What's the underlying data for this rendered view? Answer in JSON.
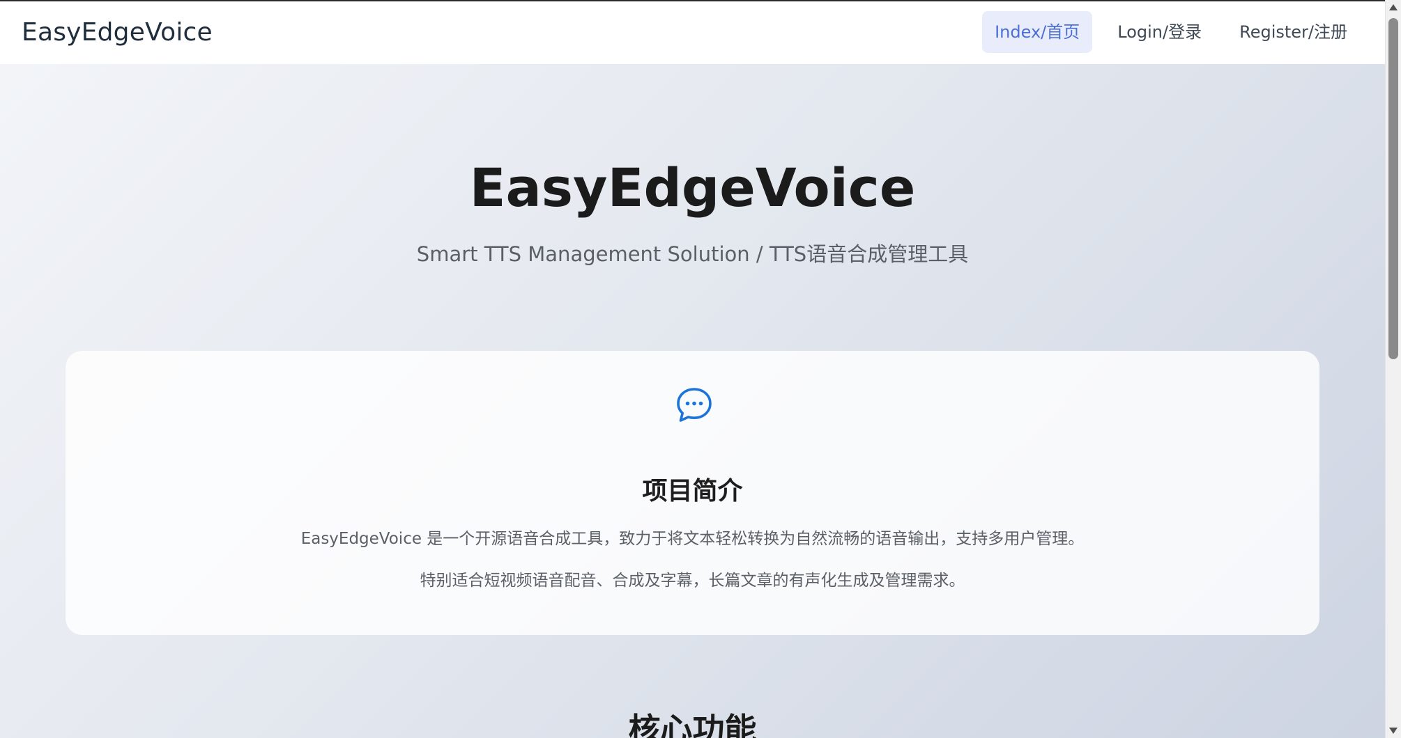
{
  "header": {
    "brand": "EasyEdgeVoice",
    "nav": [
      {
        "label": "Index/首页",
        "active": true
      },
      {
        "label": "Login/登录",
        "active": false
      },
      {
        "label": "Register/注册",
        "active": false
      }
    ]
  },
  "hero": {
    "title": "EasyEdgeVoice",
    "subtitle": "Smart TTS Management Solution / TTS语音合成管理工具"
  },
  "intro_card": {
    "icon": "chat-bubble-icon",
    "title": "项目简介",
    "line1": "EasyEdgeVoice 是一个开源语音合成工具，致力于将文本轻松转换为自然流畅的语音输出，支持多用户管理。",
    "line2": "特别适合短视频语音配音、合成及字幕，长篇文章的有声化生成及管理需求。"
  },
  "features": {
    "heading": "核心功能"
  },
  "colors": {
    "accent": "#4b6fd6",
    "icon": "#1c74d9",
    "active_nav_bg": "#e9edfb"
  }
}
